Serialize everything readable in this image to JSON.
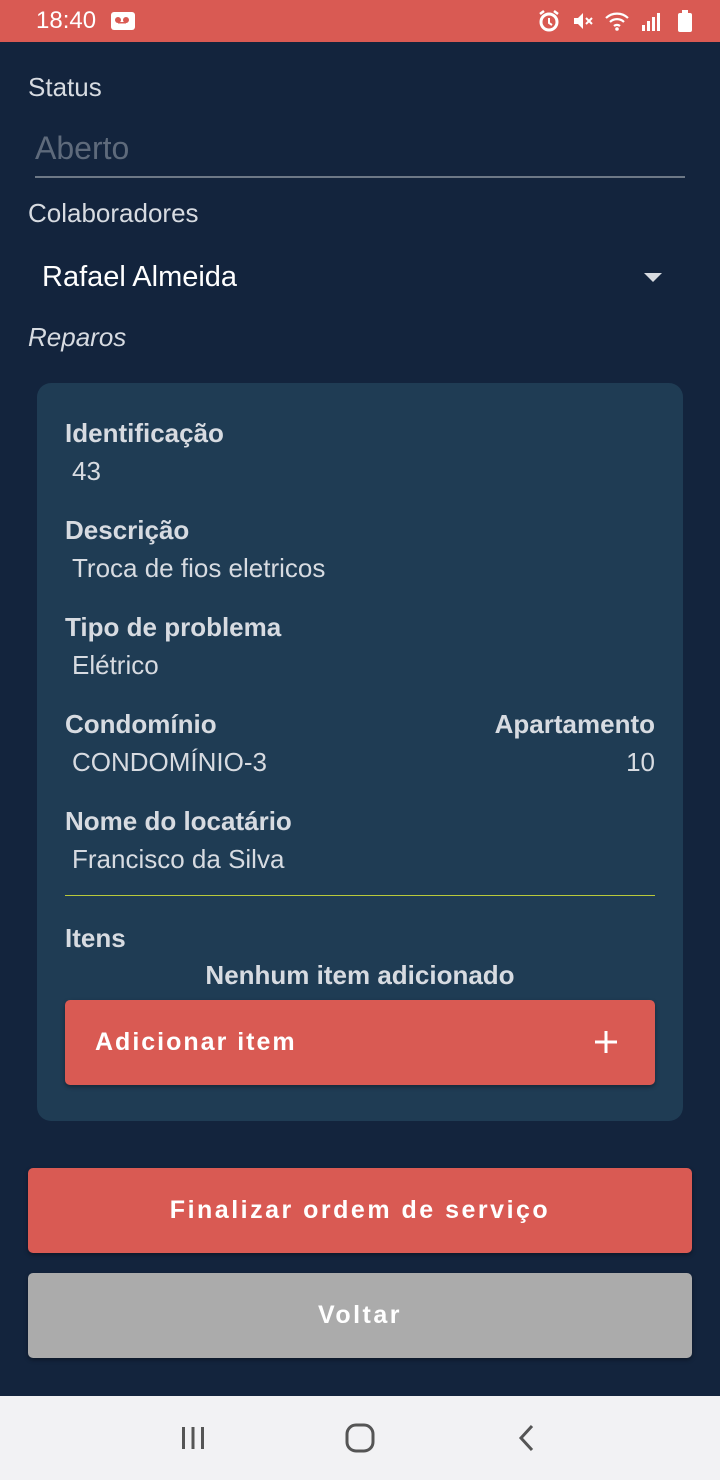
{
  "status_bar": {
    "time": "18:40"
  },
  "form": {
    "status_label": "Status",
    "status_value": "Aberto",
    "collaborators_label": "Colaboradores",
    "collaborator_selected": "Rafael Almeida",
    "repairs_label": "Reparos"
  },
  "repair_card": {
    "id_label": "Identificação",
    "id_value": "43",
    "description_label": "Descrição",
    "description_value": "Troca de fios eletricos",
    "problem_type_label": "Tipo de problema",
    "problem_type_value": "Elétrico",
    "condo_label": "Condomínio",
    "condo_value": "CONDOMÍNIO-3",
    "apartment_label": "Apartamento",
    "apartment_value": "10",
    "tenant_label": "Nome do locatário",
    "tenant_value": "Francisco da Silva",
    "items_label": "Itens",
    "no_items_text": "Nenhum item adicionado",
    "add_item_label": "Adicionar item",
    "add_icon": "plus-icon"
  },
  "actions": {
    "finish_label": "Finalizar ordem de serviço",
    "back_label": "Voltar"
  },
  "colors": {
    "accent": "#d95a53",
    "background": "#13243d",
    "card": "#1f3c54",
    "secondary_button": "#ababab",
    "divider": "#b9c93a"
  },
  "icons": {
    "status_bar": [
      "voicemail-icon",
      "alarm-icon",
      "mute-icon",
      "wifi-icon",
      "signal-icon",
      "battery-icon"
    ],
    "navigation": [
      "recents-icon",
      "home-icon",
      "back-icon"
    ]
  }
}
